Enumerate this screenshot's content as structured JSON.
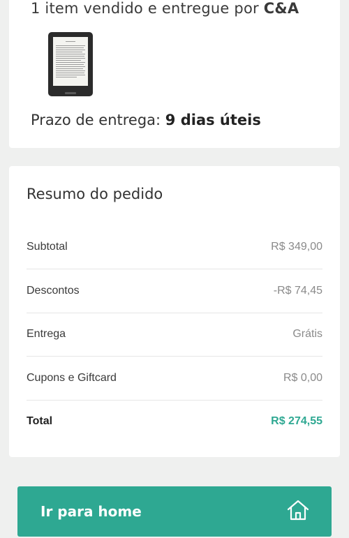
{
  "order": {
    "items_prefix": "1 item vendido e entregue por",
    "seller": "C&A",
    "product_image_icon": "kindle-ereader",
    "delivery_label": "Prazo de entrega:",
    "delivery_value": "9 dias úteis"
  },
  "summary": {
    "title": "Resumo do pedido",
    "rows": [
      {
        "label": "Subtotal",
        "value": "R$ 349,00"
      },
      {
        "label": "Descontos",
        "value": "-R$ 74,45"
      },
      {
        "label": "Entrega",
        "value": "Grátis"
      },
      {
        "label": "Cupons e Giftcard",
        "value": "R$ 0,00"
      }
    ],
    "total_label": "Total",
    "total_value": "R$ 274,55"
  },
  "cta": {
    "label": "Ir para home",
    "icon": "home-icon"
  },
  "colors": {
    "accent": "#2ea892",
    "background": "#eff0ef"
  }
}
